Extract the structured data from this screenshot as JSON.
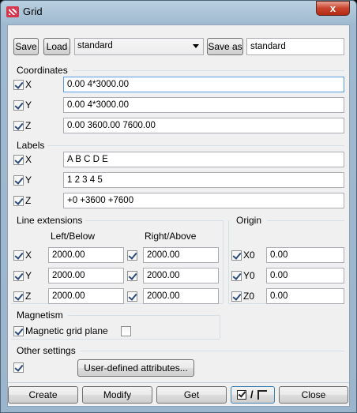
{
  "window": {
    "title": "Grid",
    "close_glyph": "x"
  },
  "toolbar": {
    "save_label": "Save",
    "load_label": "Load",
    "preset_value": "standard",
    "save_as_label": "Save as",
    "save_as_value": "standard"
  },
  "coordinates": {
    "heading": "Coordinates",
    "rows": [
      {
        "label": "X",
        "value": "0.00 4*3000.00",
        "checked": true
      },
      {
        "label": "Y",
        "value": "0.00 4*3000.00",
        "checked": true
      },
      {
        "label": "Z",
        "value": "0.00 3600.00 7600.00",
        "checked": true
      }
    ]
  },
  "labels": {
    "heading": "Labels",
    "rows": [
      {
        "label": "X",
        "value": "A B C D E",
        "checked": true
      },
      {
        "label": "Y",
        "value": "1 2 3 4 5",
        "checked": true
      },
      {
        "label": "Z",
        "value": "+0 +3600 +7600",
        "checked": true
      }
    ]
  },
  "line_extensions": {
    "heading": "Line extensions",
    "col_left": "Left/Below",
    "col_right": "Right/Above",
    "rows": [
      {
        "label": "X",
        "left": "2000.00",
        "right": "2000.00"
      },
      {
        "label": "Y",
        "left": "2000.00",
        "right": "2000.00"
      },
      {
        "label": "Z",
        "left": "2000.00",
        "right": "2000.00"
      }
    ]
  },
  "origin": {
    "heading": "Origin",
    "rows": [
      {
        "label": "X0",
        "value": "0.00"
      },
      {
        "label": "Y0",
        "value": "0.00"
      },
      {
        "label": "Z0",
        "value": "0.00"
      }
    ]
  },
  "magnetism": {
    "heading": "Magnetism",
    "option_label": "Magnetic grid plane"
  },
  "other_settings": {
    "heading": "Other settings",
    "user_defined_label": "User-defined attributes..."
  },
  "footer": {
    "create_label": "Create",
    "modify_label": "Modify",
    "get_label": "Get",
    "toggle_separator": "/",
    "close_label": "Close"
  }
}
